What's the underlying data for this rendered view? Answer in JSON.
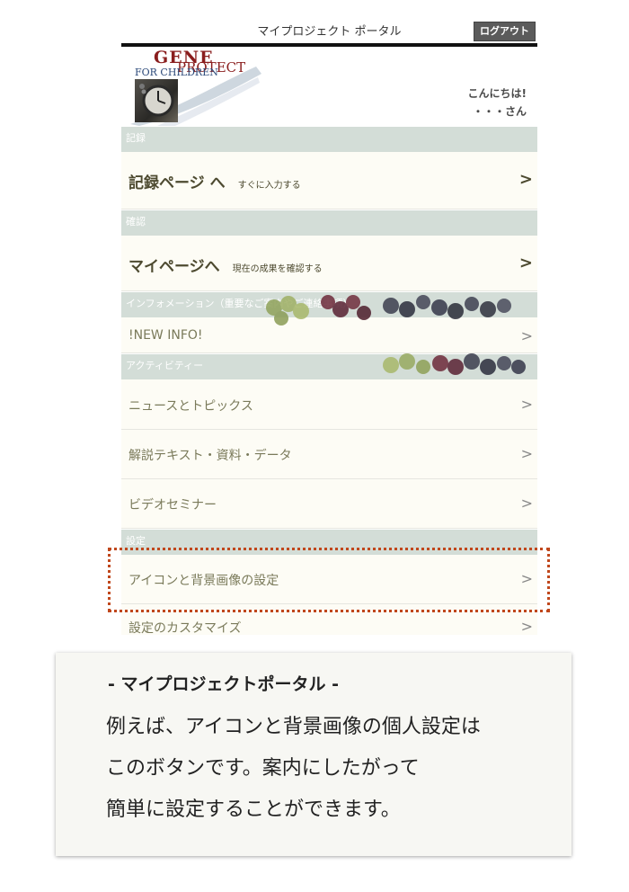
{
  "topbar": {
    "title": "マイプロジェクト ポータル",
    "logout_label": "ログアウト"
  },
  "logo": {
    "line1": "GENE",
    "line2": "PROTECT",
    "line3": "FOR CHILDREN"
  },
  "greeting": {
    "line1": "こんにちは!",
    "line2": "・・・さん"
  },
  "sections": {
    "record": "記録",
    "confirm": "確認",
    "info": "インフォメーション（重要なご案内やご連絡事項）",
    "activity": "アクティビティー",
    "settings": "設定"
  },
  "rows": {
    "record_page": {
      "label": "記録ページ へ",
      "sub": "すぐに入力する",
      "chevron": ">"
    },
    "my_page": {
      "label": "マイページへ",
      "sub": "現在の成果を確認する",
      "chevron": ">"
    },
    "new_info": {
      "label": "!NEW INFO!",
      "chevron": ">"
    },
    "news": {
      "label": "ニュースとトピックス",
      "chevron": ">"
    },
    "docs": {
      "label": "解説テキスト・資料・データ",
      "chevron": ">"
    },
    "video": {
      "label": "ビデオセミナー",
      "chevron": ">"
    },
    "icon_bg": {
      "label": "アイコンと背景画像の設定",
      "chevron": ">"
    },
    "customize": {
      "label": "設定のカスタマイズ",
      "chevron": ">"
    }
  },
  "caption": {
    "title": "- マイプロジェクトポータル -",
    "line1": "例えば、アイコンと背景画像の個人設定は",
    "line2": "このボタンです。案内にしたがって",
    "line3": "簡単に設定することができます。"
  },
  "colors": {
    "highlight": "#c0471c",
    "section_bar": "#d3ddd7",
    "row_bg": "#fdfcf5"
  }
}
